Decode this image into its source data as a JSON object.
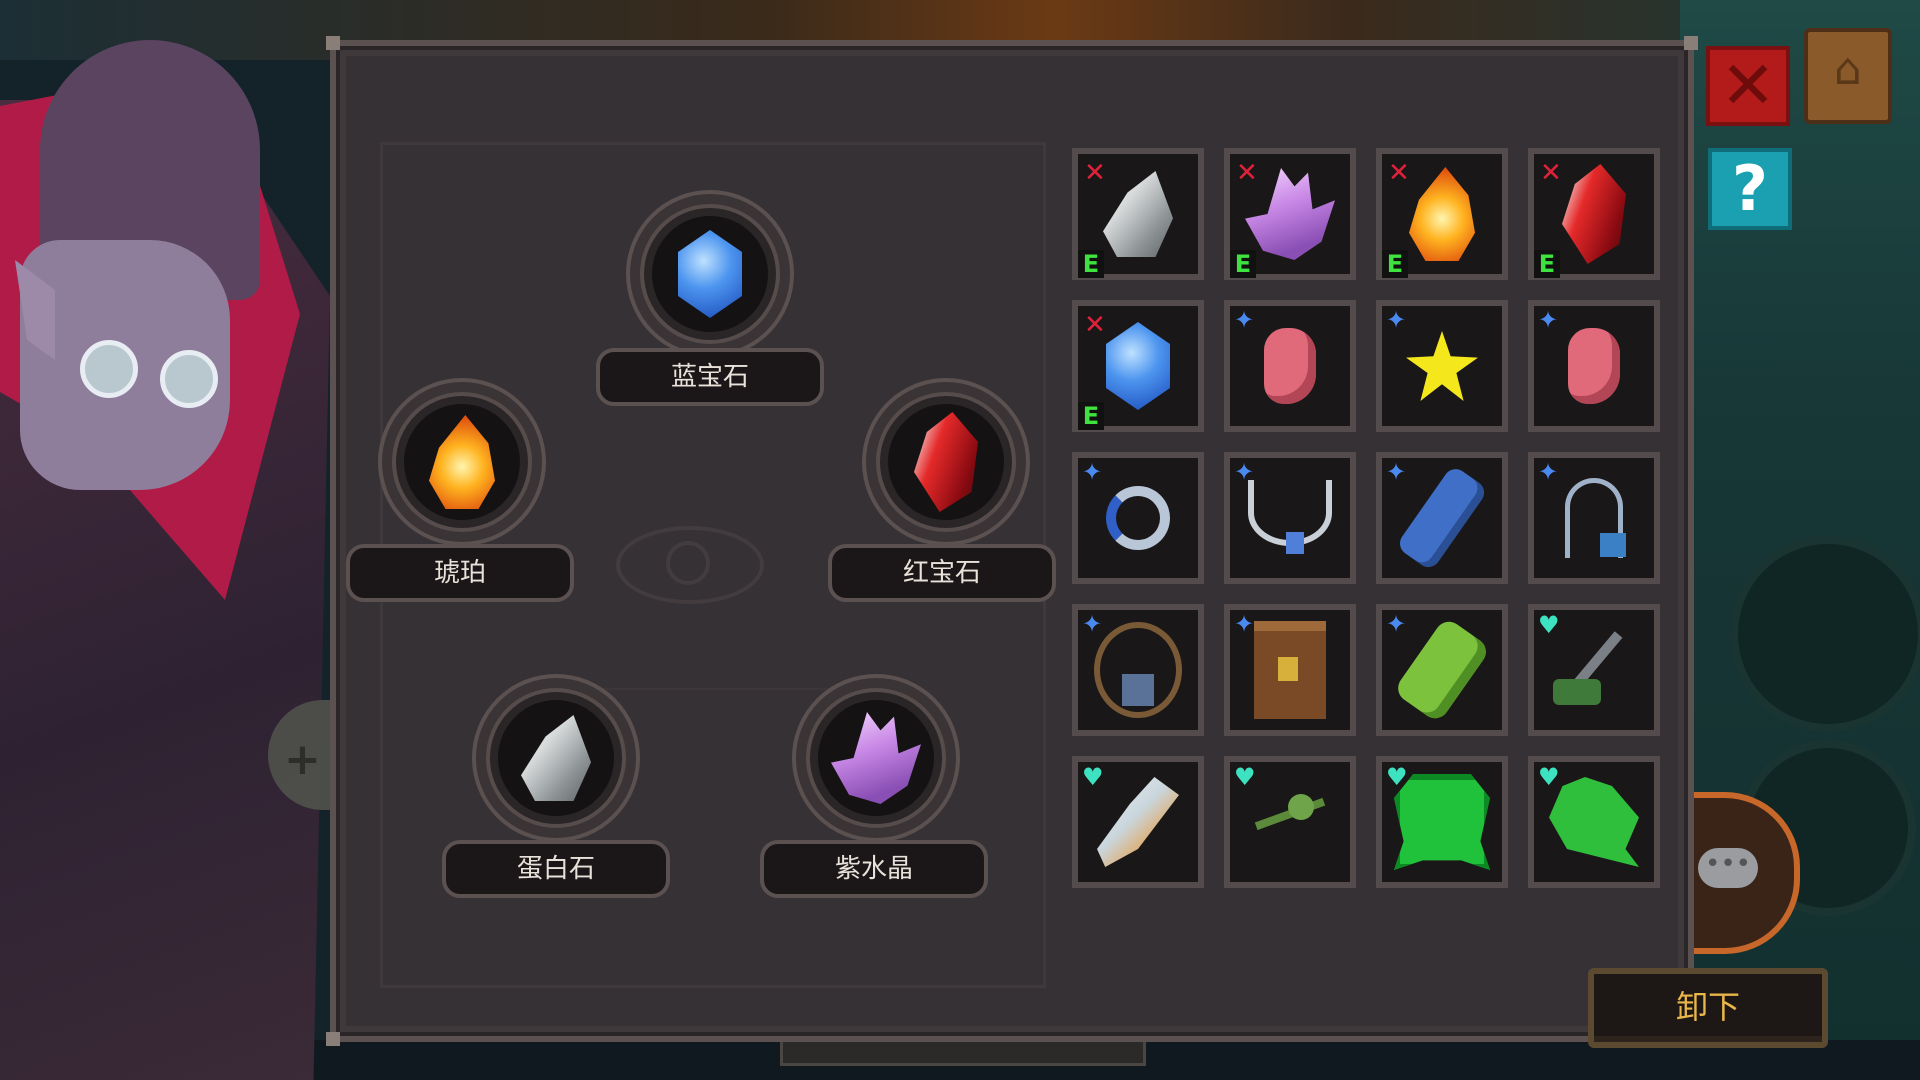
{
  "panel": {
    "sockets": [
      {
        "id": "sapphire",
        "label": "蓝宝石",
        "icon": "sapphire-icon",
        "color": "#3f7fe0"
      },
      {
        "id": "amber",
        "label": "琥珀",
        "icon": "amber-icon",
        "color": "#f29a18"
      },
      {
        "id": "ruby",
        "label": "红宝石",
        "icon": "ruby-icon",
        "color": "#c51a22"
      },
      {
        "id": "opal",
        "label": "蛋白石",
        "icon": "opal-icon",
        "color": "#c9cfd2"
      },
      {
        "id": "amethyst",
        "label": "紫水晶",
        "icon": "amethyst-icon",
        "color": "#b879dc"
      }
    ],
    "unload_label": "卸下"
  },
  "inventory": {
    "items": [
      {
        "icon": "opal-gem-icon",
        "badge": "unequip",
        "equipped_label": "E"
      },
      {
        "icon": "amethyst-gem-icon",
        "badge": "unequip",
        "equipped_label": "E"
      },
      {
        "icon": "amber-gem-icon",
        "badge": "unequip",
        "equipped_label": "E"
      },
      {
        "icon": "ruby-gem-icon",
        "badge": "unequip",
        "equipped_label": "E"
      },
      {
        "icon": "sapphire-gem-icon",
        "badge": "unequip",
        "equipped_label": "E"
      },
      {
        "icon": "meat-icon",
        "badge": "new"
      },
      {
        "icon": "star-icon",
        "badge": "new"
      },
      {
        "icon": "meat-icon",
        "badge": "new"
      },
      {
        "icon": "ring-icon",
        "badge": "new"
      },
      {
        "icon": "necklace-icon",
        "badge": "new"
      },
      {
        "icon": "blue-potion-icon",
        "badge": "new"
      },
      {
        "icon": "key-charm-icon",
        "badge": "new"
      },
      {
        "icon": "amulet-icon",
        "badge": "new"
      },
      {
        "icon": "scroll-icon",
        "badge": "new"
      },
      {
        "icon": "green-bottle-icon",
        "badge": "new"
      },
      {
        "icon": "spatula-icon",
        "badge": "favorite"
      },
      {
        "icon": "feather-icon",
        "badge": "favorite"
      },
      {
        "icon": "clover-icon",
        "badge": "favorite"
      },
      {
        "icon": "frog-icon",
        "badge": "favorite"
      },
      {
        "icon": "leaf-icon",
        "badge": "favorite"
      }
    ]
  },
  "controls": {
    "close_icon": "close-icon",
    "journal_icon": "journal-icon",
    "help_label": "?",
    "chat_icon": "chat-icon"
  },
  "colors": {
    "panel_bg": "#363134",
    "badge_unequip": "#e0213a",
    "badge_new": "#4a8af0",
    "badge_favorite": "#3de2c0",
    "equipped": "#3fe33f",
    "unload_text": "#e9b64a"
  }
}
